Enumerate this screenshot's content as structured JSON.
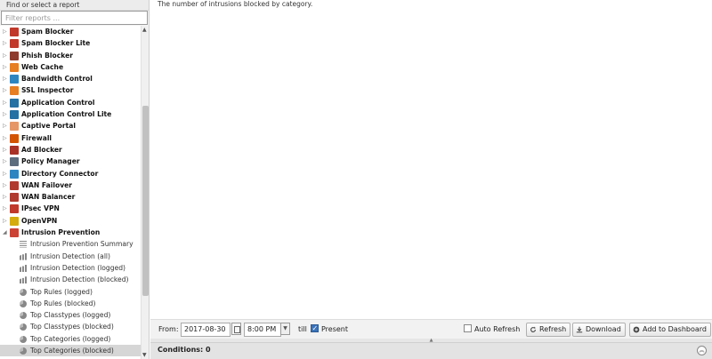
{
  "sidebar": {
    "header": "Find or select a report",
    "filter_placeholder": "Filter reports ...",
    "apps": [
      {
        "label": "Spam Blocker",
        "icon": "spam-blocker-icon",
        "color": "#c0392b"
      },
      {
        "label": "Spam Blocker Lite",
        "icon": "spam-blocker-lite-icon",
        "color": "#c0392b"
      },
      {
        "label": "Phish Blocker",
        "icon": "phish-blocker-icon",
        "color": "#8e3b2d"
      },
      {
        "label": "Web Cache",
        "icon": "web-cache-icon",
        "color": "#e67e22"
      },
      {
        "label": "Bandwidth Control",
        "icon": "bandwidth-control-icon",
        "color": "#2e86c1"
      },
      {
        "label": "SSL Inspector",
        "icon": "ssl-inspector-icon",
        "color": "#e67e22"
      },
      {
        "label": "Application Control",
        "icon": "application-control-icon",
        "color": "#2471a3"
      },
      {
        "label": "Application Control Lite",
        "icon": "application-control-lite-icon",
        "color": "#2471a3"
      },
      {
        "label": "Captive Portal",
        "icon": "captive-portal-icon",
        "color": "#e59866"
      },
      {
        "label": "Firewall",
        "icon": "firewall-icon",
        "color": "#d35400"
      },
      {
        "label": "Ad Blocker",
        "icon": "ad-blocker-icon",
        "color": "#a93226"
      },
      {
        "label": "Policy Manager",
        "icon": "policy-manager-icon",
        "color": "#5d6d7e"
      },
      {
        "label": "Directory Connector",
        "icon": "directory-connector-icon",
        "color": "#2e86c1"
      },
      {
        "label": "WAN Failover",
        "icon": "wan-failover-icon",
        "color": "#b03a2e"
      },
      {
        "label": "WAN Balancer",
        "icon": "wan-balancer-icon",
        "color": "#b03a2e"
      },
      {
        "label": "IPsec VPN",
        "icon": "ipsec-vpn-icon",
        "color": "#c0392b"
      },
      {
        "label": "OpenVPN",
        "icon": "openvpn-icon",
        "color": "#d4ac0d"
      },
      {
        "label": "Intrusion Prevention",
        "icon": "intrusion-prevention-icon",
        "color": "#cb4335"
      }
    ],
    "children": [
      {
        "label": "Intrusion Prevention Summary",
        "icon": "text-report-icon"
      },
      {
        "label": "Intrusion Detection (all)",
        "icon": "bar-chart-icon"
      },
      {
        "label": "Intrusion Detection (logged)",
        "icon": "bar-chart-icon"
      },
      {
        "label": "Intrusion Detection (blocked)",
        "icon": "bar-chart-icon"
      },
      {
        "label": "Top Rules (logged)",
        "icon": "pie-chart-icon"
      },
      {
        "label": "Top Rules (blocked)",
        "icon": "pie-chart-icon"
      },
      {
        "label": "Top Classtypes (logged)",
        "icon": "pie-chart-icon"
      },
      {
        "label": "Top Classtypes (blocked)",
        "icon": "pie-chart-icon"
      },
      {
        "label": "Top Categories (logged)",
        "icon": "pie-chart-icon"
      },
      {
        "label": "Top Categories (blocked)",
        "icon": "pie-chart-icon"
      }
    ],
    "selected_index": 9
  },
  "main": {
    "description": "The number of intrusions blocked by category."
  },
  "toolbar": {
    "from_label": "From:",
    "from_date": "2017-08-30",
    "from_time": "8:00 PM",
    "till_label": "till",
    "present_label": "Present",
    "present_checked": true,
    "auto_refresh_label": "Auto Refresh",
    "auto_refresh_checked": false,
    "refresh_label": "Refresh",
    "download_label": "Download",
    "add_dashboard_label": "Add to Dashboard"
  },
  "conditions": {
    "title": "Conditions: 0"
  },
  "colors": {
    "selected_row": "#d6d6d6",
    "checkbox_checked": "#3b73b9"
  }
}
